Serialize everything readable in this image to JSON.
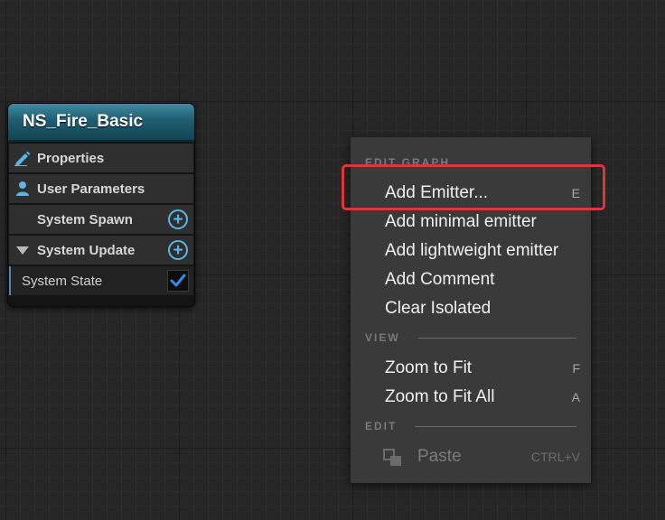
{
  "node": {
    "title": "NS_Fire_Basic",
    "rows": {
      "properties": "Properties",
      "user_parameters": "User Parameters",
      "system_spawn": "System Spawn",
      "system_update": "System Update",
      "system_state": "System State"
    },
    "system_state_checked": true,
    "header_color": "#2a6f84",
    "accent_color": "#5bb4e3"
  },
  "context_menu": {
    "sections": {
      "edit_graph": "EDIT GRAPH",
      "view": "VIEW",
      "edit": "EDIT"
    },
    "items": [
      {
        "label": "Add Emitter...",
        "shortcut": "E"
      },
      {
        "label": "Add minimal emitter",
        "shortcut": ""
      },
      {
        "label": "Add lightweight emitter",
        "shortcut": ""
      },
      {
        "label": "Add Comment",
        "shortcut": ""
      },
      {
        "label": "Clear Isolated",
        "shortcut": ""
      },
      {
        "label": "Zoom to Fit",
        "shortcut": "F"
      },
      {
        "label": "Zoom to Fit All",
        "shortcut": "A"
      },
      {
        "label": "Paste",
        "shortcut": "CTRL+V",
        "disabled": true
      }
    ]
  },
  "highlight_color": "#e03535"
}
